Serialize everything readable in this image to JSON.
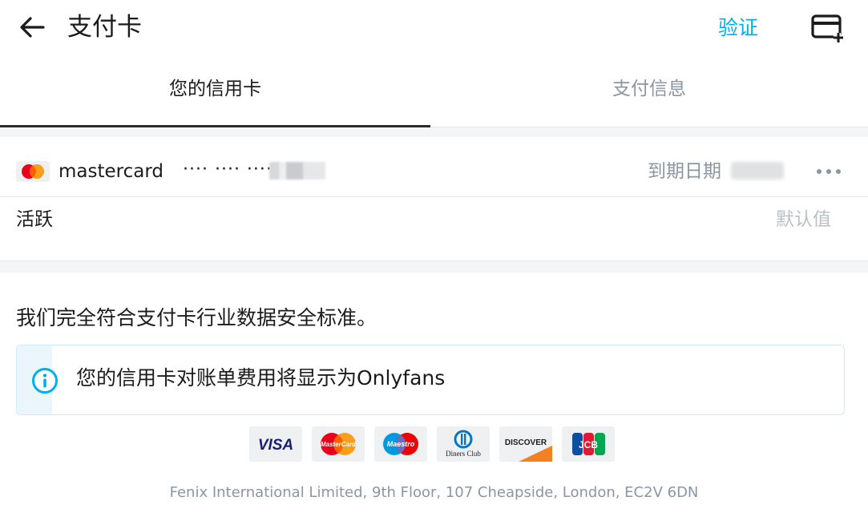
{
  "header": {
    "title": "支付卡",
    "verify_label": "验证",
    "icons": {
      "back": "arrow-left-icon",
      "add_card": "add-card-icon"
    },
    "accent_color": "#00aff0"
  },
  "tabs": [
    {
      "label": "您的信用卡",
      "active": true
    },
    {
      "label": "支付信息",
      "active": false
    }
  ],
  "card": {
    "brand": "mastercard",
    "masked_number": "···· ···· ····",
    "expiry_label": "到期日期",
    "status": "活跃",
    "default_label": "默认值",
    "icons": {
      "brand": "mastercard-icon",
      "more": "more-horizontal-icon"
    }
  },
  "compliance_text": "我们完全符合支付卡行业数据安全标准。",
  "info": {
    "text": "您的信用卡对账单费用将显示为Onlyfans",
    "icon": "info-icon"
  },
  "payment_logos": [
    {
      "name": "visa-logo",
      "text": "VISA"
    },
    {
      "name": "mastercard-logo",
      "text": "MasterCard"
    },
    {
      "name": "maestro-logo",
      "text": "Maestro"
    },
    {
      "name": "diners-club-logo",
      "text": "Diners Club"
    },
    {
      "name": "discover-logo",
      "text": "DISCOVER"
    },
    {
      "name": "jcb-logo",
      "text": "JCB"
    }
  ],
  "footer": {
    "address": "Fenix International Limited, 9th Floor, 107 Cheapside, London, EC2V 6DN"
  }
}
